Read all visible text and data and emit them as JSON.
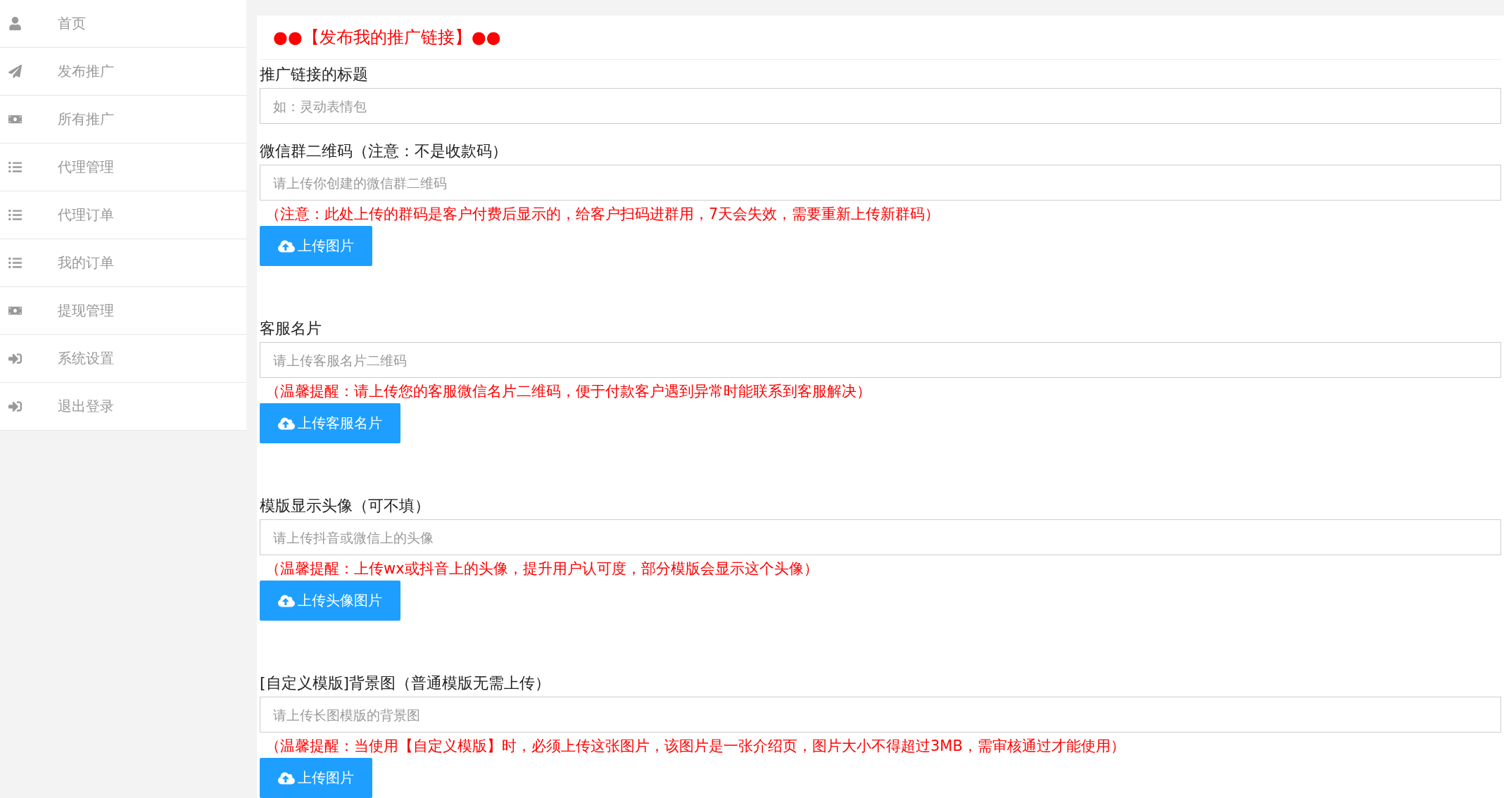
{
  "sidebar": {
    "items": [
      {
        "label": "首页",
        "kind": "user"
      },
      {
        "label": "发布推广",
        "kind": "plane"
      },
      {
        "label": "所有推广",
        "kind": "money"
      },
      {
        "label": "代理管理",
        "kind": "list"
      },
      {
        "label": "代理订单",
        "kind": "list"
      },
      {
        "label": "我的订单",
        "kind": "list"
      },
      {
        "label": "提现管理",
        "kind": "money"
      },
      {
        "label": "系统设置",
        "kind": "signin"
      },
      {
        "label": "退出登录",
        "kind": "signin"
      }
    ]
  },
  "form": {
    "title": "●●【发布我的推广链接】●●",
    "sections": [
      {
        "label": "推广链接的标题",
        "placeholder": "如：灵动表情包"
      },
      {
        "label": "微信群二维码（注意：不是收款码）",
        "placeholder": "请上传你创建的微信群二维码",
        "note": "（注意：此处上传的群码是客户付费后显示的，给客户扫码进群用，7天会失效，需要重新上传新群码）",
        "button": "上传图片"
      },
      {
        "label": "客服名片",
        "placeholder": "请上传客服名片二维码",
        "note": "（温馨提醒：请上传您的客服微信名片二维码，便于付款客户遇到异常时能联系到客服解决）",
        "button": "上传客服名片"
      },
      {
        "label": "模版显示头像（可不填）",
        "placeholder": "请上传抖音或微信上的头像",
        "note": "（温馨提醒：上传wx或抖音上的头像，提升用户认可度，部分模版会显示这个头像）",
        "button": "上传头像图片"
      },
      {
        "label": "[自定义模版]背景图（普通模版无需上传）",
        "placeholder": "请上传长图模版的背景图",
        "note": "（温馨提醒：当使用【自定义模版】时，必须上传这张图片，该图片是一张介绍页，图片大小不得超过3MB，需审核通过才能使用）",
        "button": "上传图片"
      }
    ]
  }
}
